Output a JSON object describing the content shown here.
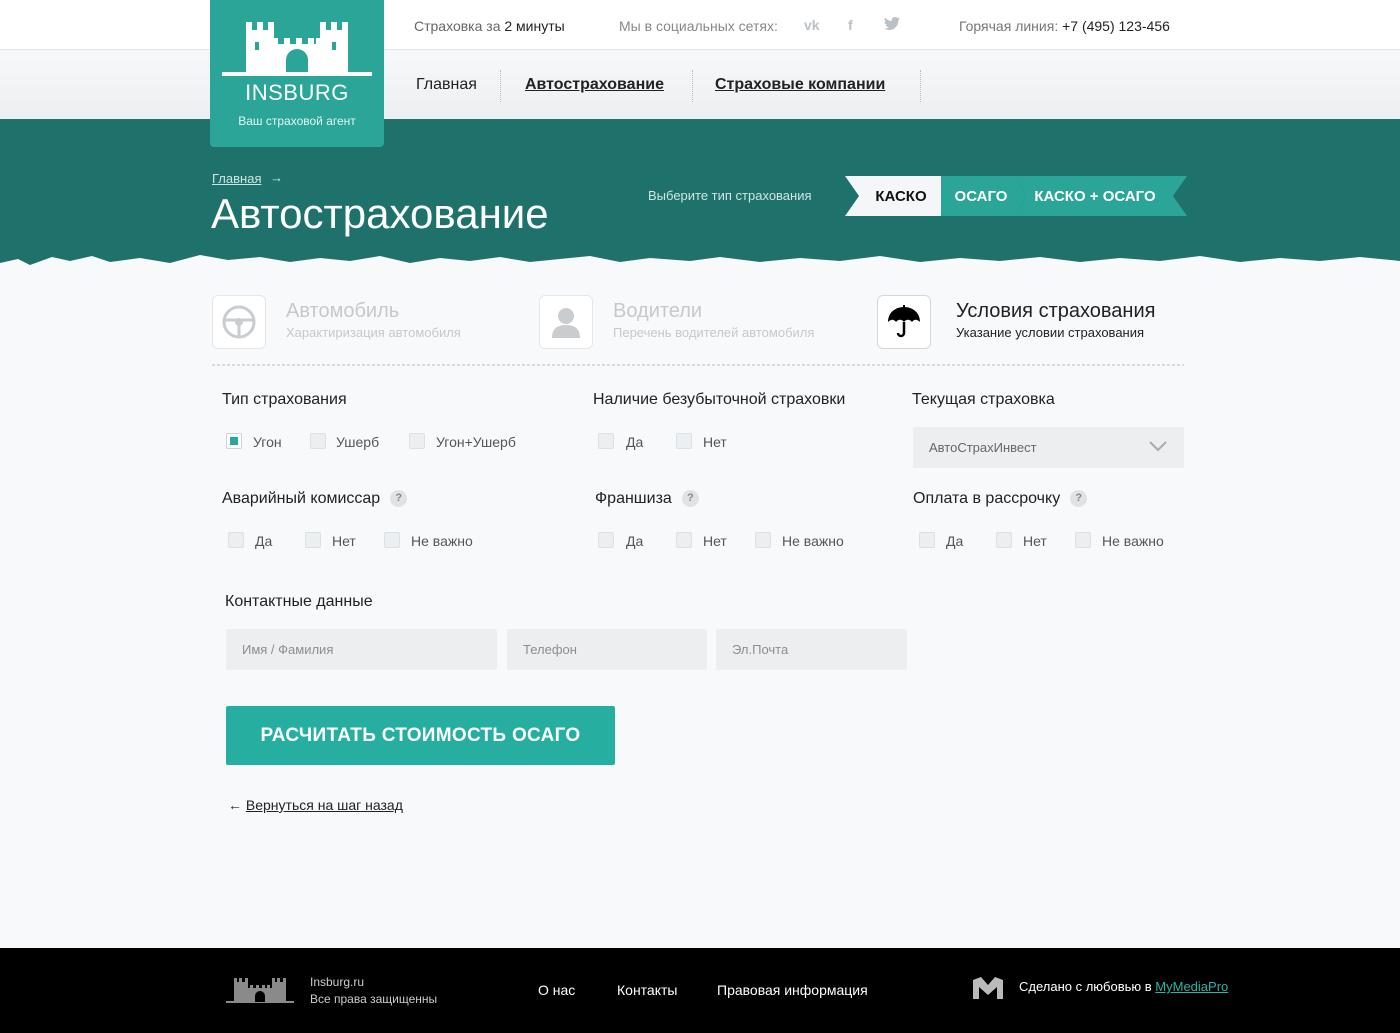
{
  "colors": {
    "accent": "#26aea0",
    "hero_bg": "#1f726b",
    "logo_bg": "#2aa597",
    "footer_bg": "#000000"
  },
  "topbar": {
    "tagline_prefix": "Страховка за ",
    "tagline_emph": "2 минуты",
    "social_label": "Мы в социальных сетях:",
    "social_icons": [
      "vk-icon",
      "facebook-icon",
      "twitter-icon"
    ],
    "hotline_label": "Горячая линия: ",
    "hotline_phone": "+7 (495) 123-456"
  },
  "logo": {
    "brand": "INSBURG",
    "subtitle": "Ваш страховой агент"
  },
  "nav": {
    "home": "Главная",
    "auto": "Автострахование",
    "companies": "Страховые компании"
  },
  "hero": {
    "breadcrumb": "Главная",
    "title": "Автострахование",
    "choose_label": "Выберите тип страхования",
    "tabs": [
      "КАСКО",
      "ОСАГО",
      "КАСКО + ОСАГО"
    ],
    "active_tab": "КАСКО"
  },
  "steps": [
    {
      "title": "Автомобиль",
      "subtitle": "Характиризация автомобиля",
      "icon": "steering-wheel-icon",
      "active": false
    },
    {
      "title": "Водители",
      "subtitle": "Перечень водителей автомобиля",
      "icon": "driver-icon",
      "active": false
    },
    {
      "title": "Условия страхования",
      "subtitle": "Указание условии страхования",
      "icon": "umbrella-icon",
      "active": true
    }
  ],
  "form": {
    "insurance_type": {
      "label": "Тип страхования",
      "options": [
        "Угон",
        "Ушерб",
        "Угон+Ушерб"
      ],
      "checked": "Угон"
    },
    "no_claims": {
      "label": "Наличие безубыточной страховки",
      "options": [
        "Да",
        "Нет"
      ]
    },
    "current": {
      "label": "Текущая страховка",
      "value": "АвтоСтрахИнвест"
    },
    "commissioner": {
      "label": "Аварийный комиссар",
      "help": "?",
      "options": [
        "Да",
        "Нет",
        "Не важно"
      ]
    },
    "franchise": {
      "label": "Франшиза",
      "help": "?",
      "options": [
        "Да",
        "Нет",
        "Не важно"
      ]
    },
    "installment": {
      "label": "Оплата в рассрочку",
      "help": "?",
      "options": [
        "Да",
        "Нет",
        "Не важно"
      ]
    },
    "contacts": {
      "label": "Контактные данные",
      "name_placeholder": "Имя / Фамилия",
      "phone_placeholder": "Телефон",
      "email_placeholder": "Эл.Почта"
    },
    "submit": "РАСЧИТАТЬ СТОИМОСТЬ ОСАГО",
    "back": "Вернуться на шаг назад"
  },
  "footer": {
    "site": "Insburg.ru",
    "rights": "Все права защищенны",
    "links": [
      "О нас",
      "Контакты",
      "Правовая информация"
    ],
    "made_prefix": "Сделано с любовью в ",
    "made_link": "MyMediaPro"
  }
}
